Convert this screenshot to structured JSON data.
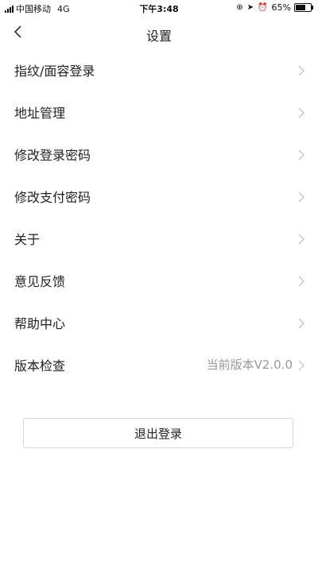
{
  "status_bar": {
    "carrier": "中国移动",
    "network": "4G",
    "time": "下午3:48",
    "battery_percent": "65%",
    "battery_level": 0.65
  },
  "nav": {
    "title": "设置",
    "back_icon": "chevron-left-icon"
  },
  "menu": {
    "items": [
      {
        "label": "指纹/面容登录"
      },
      {
        "label": "地址管理"
      },
      {
        "label": "修改登录密码"
      },
      {
        "label": "修改支付密码"
      },
      {
        "label": "关于"
      },
      {
        "label": "意见反馈"
      },
      {
        "label": "帮助中心"
      },
      {
        "label": "版本检查",
        "value": "当前版本V2.0.0"
      }
    ]
  },
  "logout": {
    "label": "退出登录"
  },
  "colors": {
    "text": "#222222",
    "secondary_text": "#999999",
    "chevron": "#c7c7cc",
    "button_border": "#d6d6d6"
  }
}
